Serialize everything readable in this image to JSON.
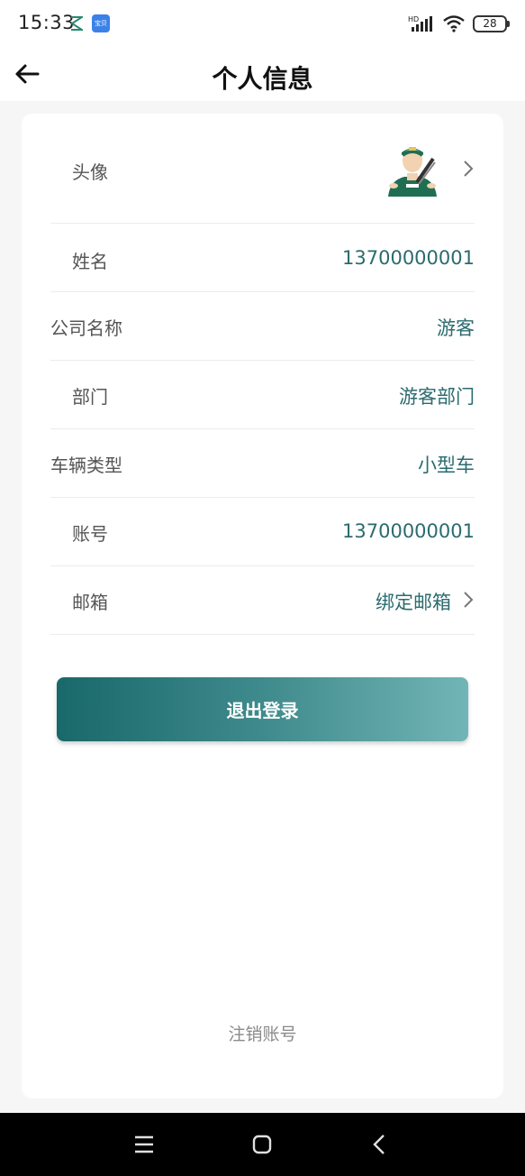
{
  "status_bar": {
    "time": "15:33",
    "app_badge": "宝贝",
    "network": "HD",
    "battery": "28"
  },
  "header": {
    "title": "个人信息"
  },
  "profile": {
    "avatar_label": "头像",
    "name_label": "姓名",
    "name_value": "13700000001",
    "company_label": "公司名称",
    "company_value": "游客",
    "department_label": "部门",
    "department_value": "游客部门",
    "vehicle_label": "车辆类型",
    "vehicle_value": "小型车",
    "account_label": "账号",
    "account_value": "13700000001",
    "email_label": "邮箱",
    "email_value": "绑定邮箱"
  },
  "actions": {
    "logout": "退出登录",
    "cancel_account": "注销账号"
  },
  "colors": {
    "accent": "#2b6b6e",
    "button_start": "#19686a",
    "button_end": "#72b5b6"
  }
}
